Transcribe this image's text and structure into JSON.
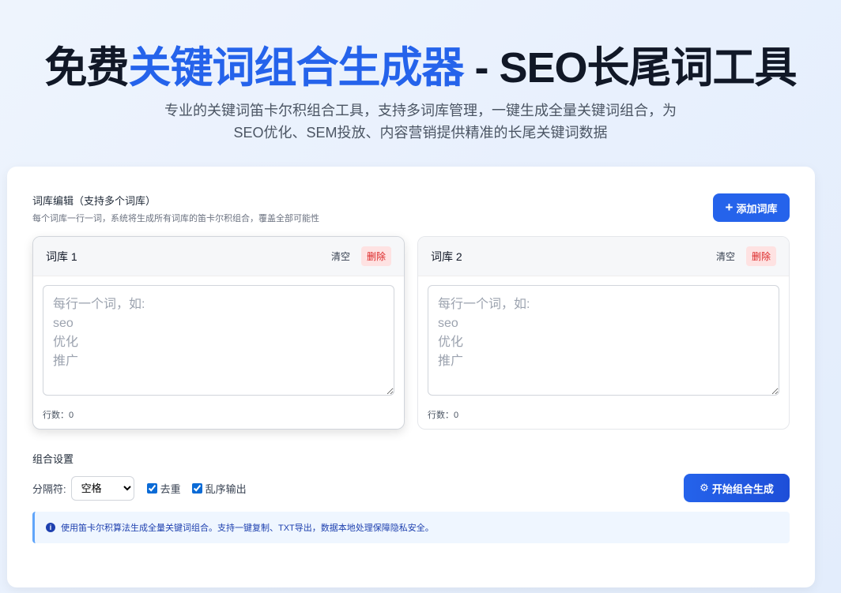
{
  "hero": {
    "title_pre": "免费",
    "title_hl": "关键词组合生成器",
    "title_post": " - SEO长尾词工具",
    "subtitle": "专业的关键词笛卡尔积组合工具，支持多词库管理，一键生成全量关键词组合，为SEO优化、SEM投放、内容营销提供精准的长尾关键词数据"
  },
  "editor": {
    "title": "词库编辑（支持多个词库）",
    "desc": "每个词库一行一词，系统将生成所有词库的笛卡尔积组合，覆盖全部可能性",
    "add_label": "添加词库"
  },
  "libraries": [
    {
      "name": "词库 1",
      "clear": "清空",
      "delete": "删除",
      "placeholder": "每行一个词，如:\nseo\n优化\n推广",
      "rows": "行数：0"
    },
    {
      "name": "词库 2",
      "clear": "清空",
      "delete": "删除",
      "placeholder": "每行一个词，如:\nseo\n优化\n推广",
      "rows": "行数：0"
    }
  ],
  "settings": {
    "title": "组合设置",
    "separator_label": "分隔符:",
    "separator_value": "空格",
    "dedupe": "去重",
    "shuffle": "乱序输出",
    "generate": "开始组合生成"
  },
  "info": "使用笛卡尔积算法生成全量关键词组合。支持一键复制、TXT导出，数据本地处理保障隐私安全。"
}
